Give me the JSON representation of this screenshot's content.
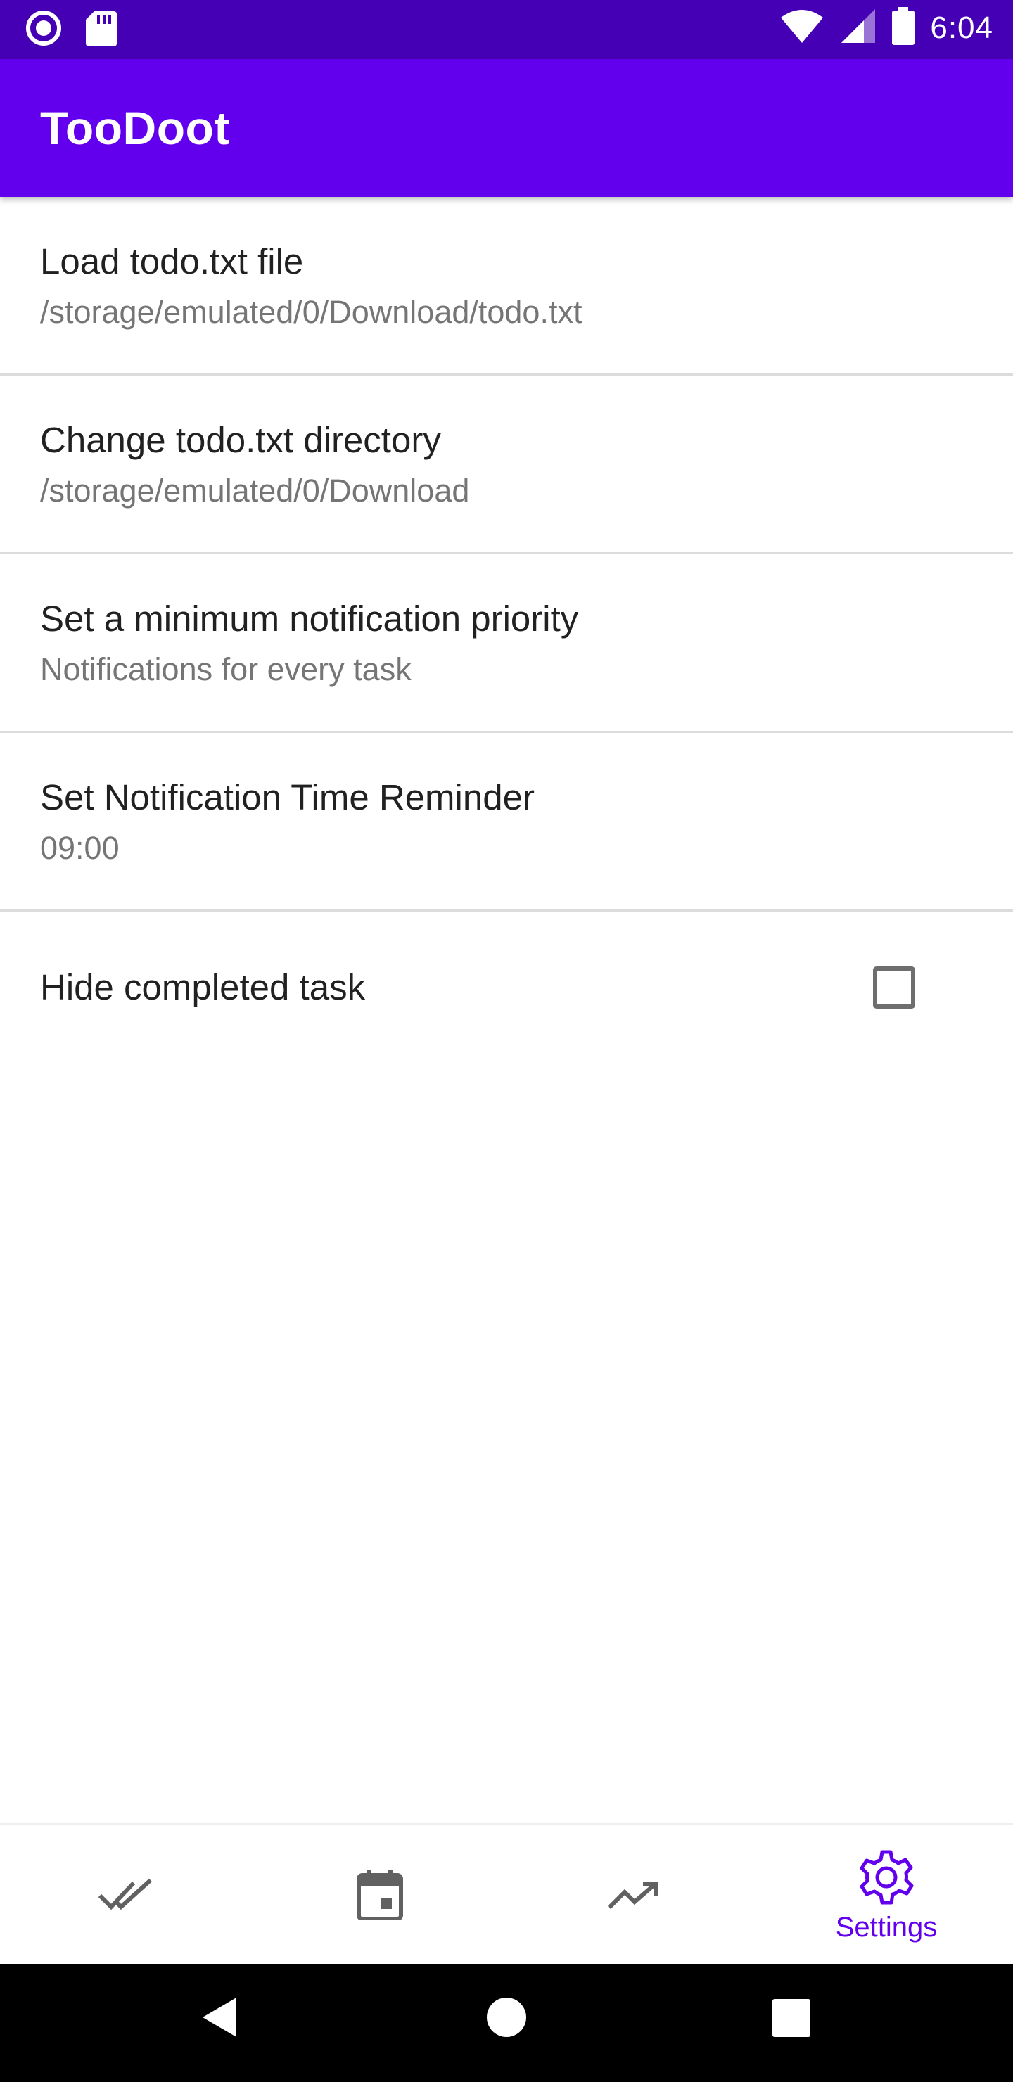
{
  "status_bar": {
    "time": "6:04",
    "left_icons": [
      "circle-notification-icon",
      "sd-card-icon"
    ],
    "right_icons": [
      "wifi-icon",
      "signal-icon",
      "battery-icon"
    ]
  },
  "app_bar": {
    "title": "TooDoot",
    "color": "#6200ee"
  },
  "preferences": [
    {
      "title": "Load todo.txt file",
      "summary": "/storage/emulated/0/Download/todo.txt"
    },
    {
      "title": "Change todo.txt directory",
      "summary": "/storage/emulated/0/Download"
    },
    {
      "title": "Set a minimum notification priority",
      "summary": "Notifications for every task"
    },
    {
      "title": "Set Notification Time Reminder",
      "summary": "09:00"
    },
    {
      "title": "Hide completed task",
      "checked": false
    }
  ],
  "bottom_nav": {
    "items": [
      {
        "icon": "done-all-icon",
        "label": ""
      },
      {
        "icon": "calendar-icon",
        "label": ""
      },
      {
        "icon": "trending-up-icon",
        "label": ""
      },
      {
        "icon": "settings-icon",
        "label": "Settings",
        "active": true
      }
    ],
    "active_color": "#6200ee",
    "inactive_color": "#616161"
  },
  "system_nav": {
    "buttons": [
      "back-icon",
      "home-icon",
      "recents-icon"
    ]
  }
}
